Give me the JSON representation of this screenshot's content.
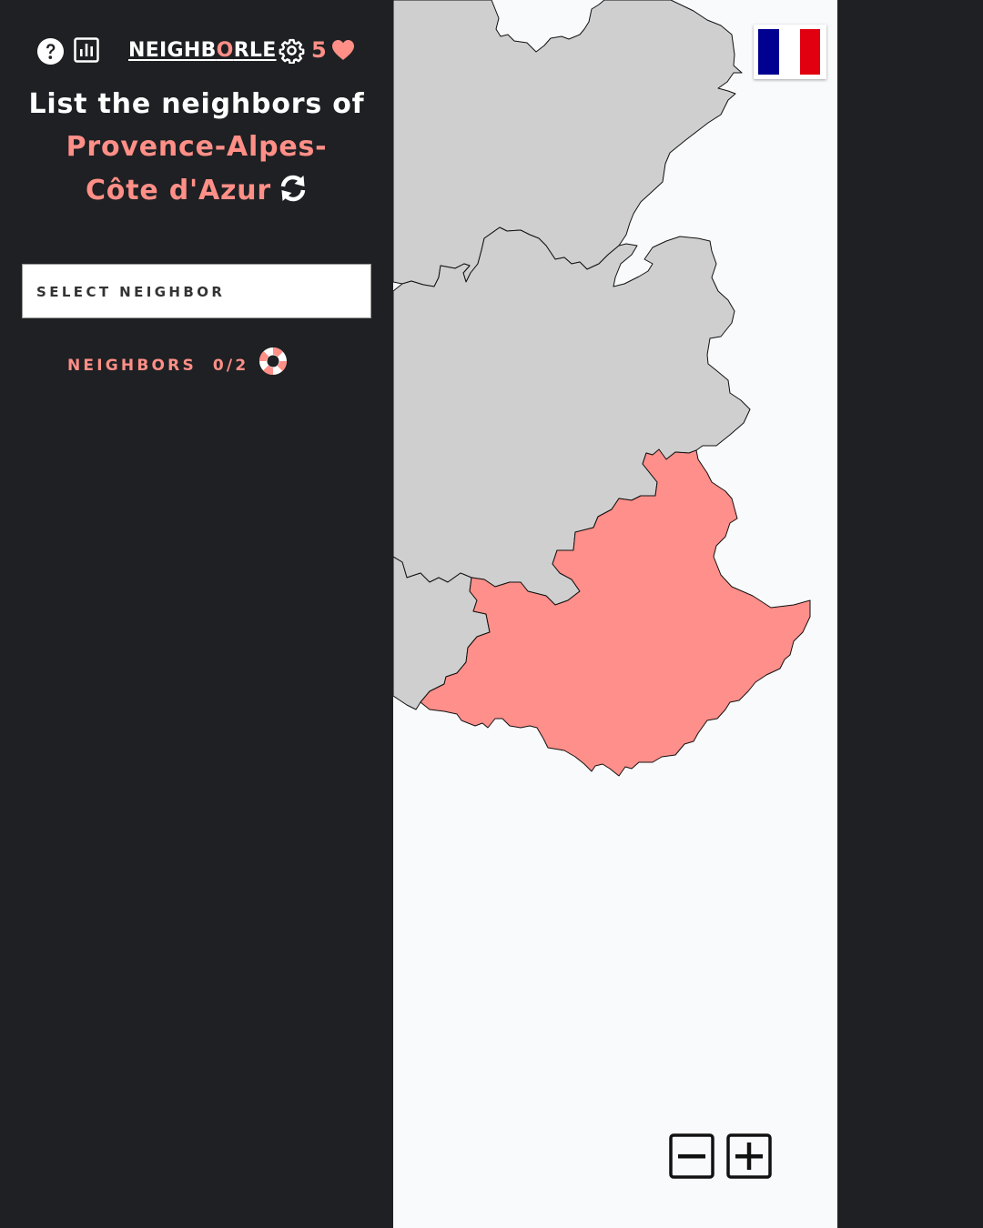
{
  "app": {
    "brand_prefix": "NEIGHB",
    "brand_highlight": "O",
    "brand_suffix": "RLE",
    "lives": "5"
  },
  "prompt": {
    "line": "List the neighbors of",
    "region": "Provence-Alpes-Côte d'Azur"
  },
  "select": {
    "placeholder": "SELECT NEIGHBOR"
  },
  "neighbors": {
    "label": "NEIGHBORS",
    "count": "0/2"
  },
  "icons": {
    "help": "help-icon",
    "stats": "stats-icon",
    "settings": "gear-icon",
    "lives": "heart-icon",
    "refresh": "refresh-icon",
    "hint": "lifebuoy-icon",
    "flag": "france-flag",
    "zoom_out": "zoom-out-icon",
    "zoom_in": "zoom-in-icon"
  },
  "colors": {
    "accent": "#ff8f87",
    "sidebar_bg": "#1f2023",
    "map_bg": "#f9fafc",
    "region_fill": "#cfcfcf",
    "target_fill": "#ff8f8a",
    "flag_blue": "#000091",
    "flag_red": "#e1000f"
  }
}
